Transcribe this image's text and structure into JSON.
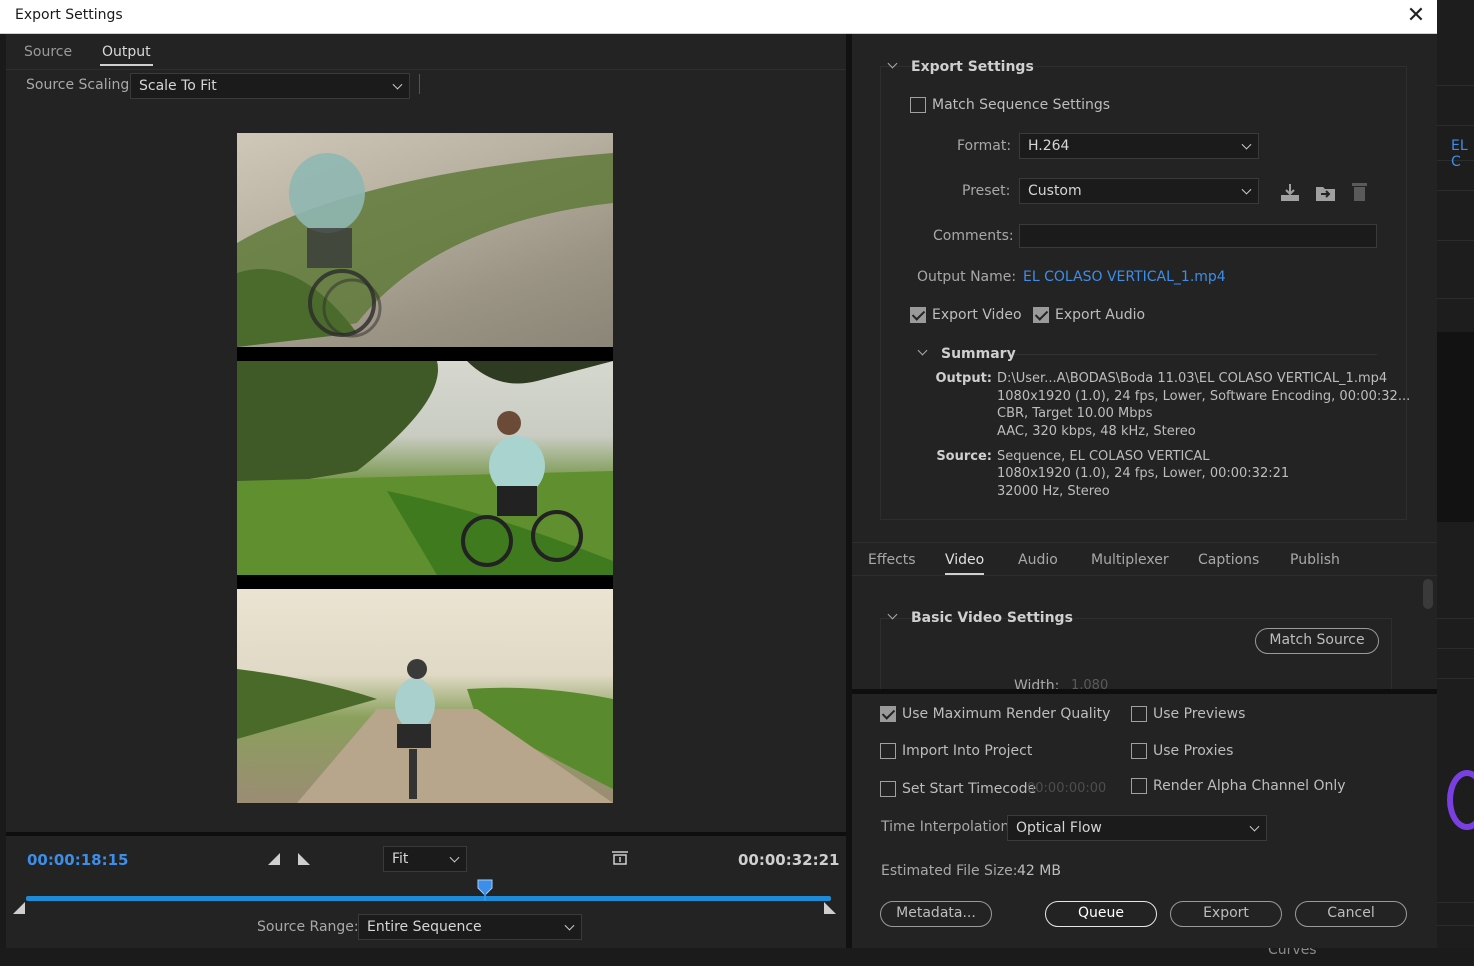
{
  "window": {
    "title": "Export Settings",
    "close_glyph": "✕"
  },
  "left": {
    "tabs": [
      {
        "label": "Source",
        "active": false
      },
      {
        "label": "Output",
        "active": true
      }
    ],
    "source_scaling": {
      "label": "Source Scaling:",
      "value": "Scale To Fit"
    },
    "current_time": "00:00:18:15",
    "duration": "00:00:32:21",
    "zoom": {
      "value": "Fit"
    },
    "source_range": {
      "label": "Source Range:",
      "value": "Entire Sequence"
    },
    "playhead_position": 0.57
  },
  "export_settings": {
    "section_title": "Export Settings",
    "match_sequence": {
      "label": "Match Sequence Settings",
      "checked": false
    },
    "format": {
      "label": "Format:",
      "value": "H.264"
    },
    "preset": {
      "label": "Preset:",
      "value": "Custom"
    },
    "comments": {
      "label": "Comments:",
      "value": ""
    },
    "output_name": {
      "label": "Output Name:",
      "value": "EL COLASO VERTICAL_1.mp4"
    },
    "export_video": {
      "label": "Export Video",
      "checked": true
    },
    "export_audio": {
      "label": "Export Audio",
      "checked": true
    },
    "summary": {
      "title": "Summary",
      "output_label": "Output:",
      "output_lines": [
        "D:\\User...A\\BODAS\\Boda 11.03\\EL COLASO VERTICAL_1.mp4",
        "1080x1920 (1.0), 24 fps, Lower, Software Encoding, 00:00:32...",
        "CBR, Target 10.00 Mbps",
        "AAC, 320 kbps, 48 kHz, Stereo"
      ],
      "source_label": "Source:",
      "source_lines": [
        "Sequence, EL COLASO VERTICAL",
        "1080x1920 (1.0), 24 fps, Lower, 00:00:32:21",
        "32000 Hz, Stereo"
      ]
    }
  },
  "tabs": [
    {
      "label": "Effects",
      "active": false
    },
    {
      "label": "Video",
      "active": true
    },
    {
      "label": "Audio",
      "active": false
    },
    {
      "label": "Multiplexer",
      "active": false
    },
    {
      "label": "Captions",
      "active": false
    },
    {
      "label": "Publish",
      "active": false
    }
  ],
  "video": {
    "basic_title": "Basic Video Settings",
    "match_source": "Match Source",
    "width_label": "Width:",
    "width_value": "1,080"
  },
  "options": {
    "max_render_quality": {
      "label": "Use Maximum Render Quality",
      "checked": true
    },
    "use_previews": {
      "label": "Use Previews",
      "checked": false
    },
    "import_into_project": {
      "label": "Import Into Project",
      "checked": false
    },
    "use_proxies": {
      "label": "Use Proxies",
      "checked": false
    },
    "set_start_timecode": {
      "label": "Set Start Timecode",
      "checked": false,
      "value": "00:00:00:00"
    },
    "render_alpha": {
      "label": "Render Alpha Channel Only",
      "checked": false
    },
    "time_interpolation": {
      "label": "Time Interpolation:",
      "value": "Optical Flow"
    },
    "file_size": {
      "label": "Estimated File Size:",
      "value": "42 MB"
    }
  },
  "buttons": {
    "metadata": "Metadata...",
    "queue": "Queue",
    "export": "Export",
    "cancel": "Cancel"
  },
  "background_app": {
    "tab_text": "EL C",
    "panel_label": "Curves"
  },
  "colors": {
    "accent_blue": "#3d8ee8",
    "timeline_blue": "#1f8ad6",
    "panel_bg": "#232323"
  }
}
